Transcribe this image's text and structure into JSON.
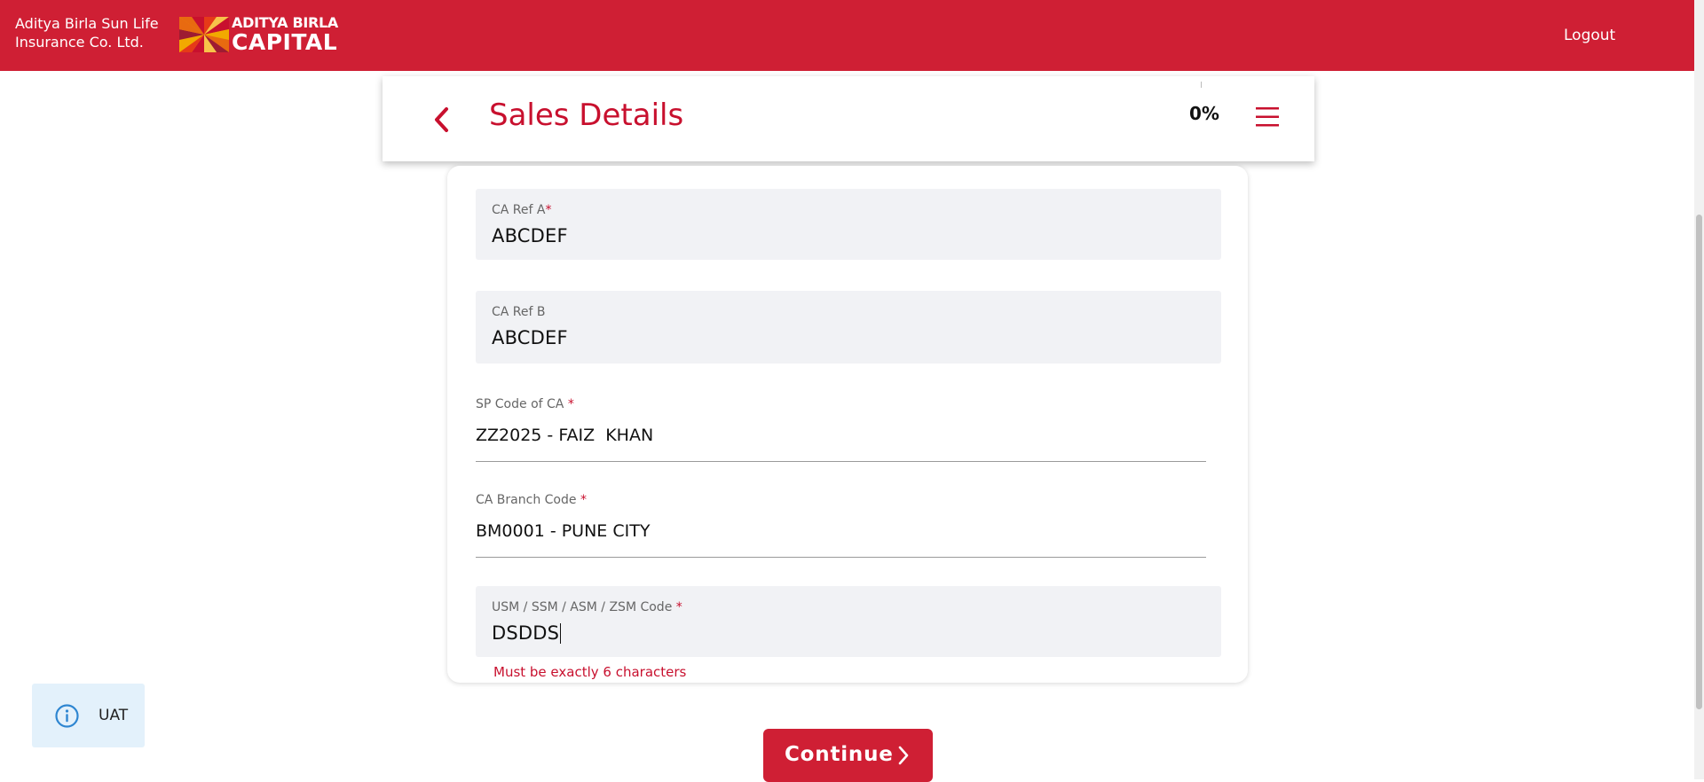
{
  "header": {
    "brand_text_line1": "Aditya Birla Sun Life",
    "brand_text_line2": "Insurance Co. Ltd.",
    "logo_line1": "ADITYA BIRLA",
    "logo_line2": "CAPITAL",
    "logout_label": "Logout",
    "color": "#cf1f34"
  },
  "page": {
    "title": "Sales Details",
    "progress": "0%",
    "back_icon": "chevron-left-icon",
    "menu_icon": "hamburger-menu-icon"
  },
  "form": {
    "ca_ref_a": {
      "label": "CA Ref A",
      "required_mark": "*",
      "value": "ABCDEF"
    },
    "ca_ref_b": {
      "label": "CA Ref B",
      "value": "ABCDEF"
    },
    "sp_code": {
      "label": "SP Code of CA",
      "required_mark": "*",
      "value": "ZZ2025 - FAIZ  KHAN"
    },
    "branch_code": {
      "label": "CA Branch Code",
      "required_mark": "*",
      "value": "BM0001 - PUNE CITY"
    },
    "manager_code": {
      "label": "USM / SSM / ASM / ZSM Code",
      "required_mark": "*",
      "value": "DSDDS",
      "error": "Must be exactly 6 characters"
    }
  },
  "uat_badge": {
    "label": "UAT",
    "icon": "info-icon"
  },
  "continue_button": {
    "label": "Continue",
    "icon": "chevron-right-icon"
  }
}
